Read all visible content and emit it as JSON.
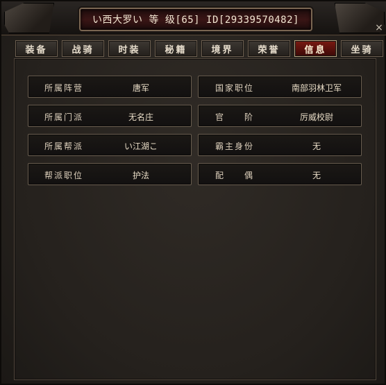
{
  "window": {
    "title": "い西大罗い 等 级[65] ID[29339570482]",
    "close_label": "×"
  },
  "tabs": [
    {
      "label": "装备",
      "active": false
    },
    {
      "label": "战骑",
      "active": false
    },
    {
      "label": "时装",
      "active": false
    },
    {
      "label": "秘籍",
      "active": false
    },
    {
      "label": "境界",
      "active": false
    },
    {
      "label": "荣誉",
      "active": false
    },
    {
      "label": "信息",
      "active": true
    },
    {
      "label": "坐骑",
      "active": false
    }
  ],
  "info": {
    "left": [
      {
        "label": "所属阵营",
        "value": "唐军"
      },
      {
        "label": "所属门派",
        "value": "无名庄"
      },
      {
        "label": "所属帮派",
        "value": "い江湖こ"
      },
      {
        "label": "帮派职位",
        "value": "护法"
      }
    ],
    "right": [
      {
        "label": "国家职位",
        "value": "南部羽林卫军"
      },
      {
        "label": "官　　阶",
        "value": "厉威校尉"
      },
      {
        "label": "霸主身份",
        "value": "无"
      },
      {
        "label": "配　　偶",
        "value": "无"
      }
    ]
  }
}
